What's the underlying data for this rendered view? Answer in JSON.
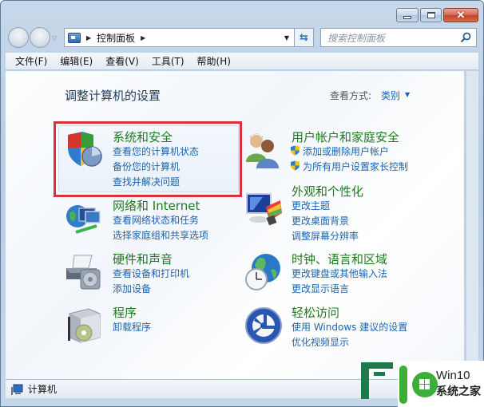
{
  "window": {
    "caption_buttons": {
      "minimize": "minimize",
      "maximize": "maximize",
      "close": "close"
    }
  },
  "navbar": {
    "address_crumbs": [
      "控制面板"
    ],
    "search_placeholder": "搜索控制面板"
  },
  "menubar": {
    "items": [
      "文件(F)",
      "编辑(E)",
      "查看(V)",
      "工具(T)",
      "帮助(H)"
    ]
  },
  "content": {
    "title": "调整计算机的设置",
    "view_by_label": "查看方式:",
    "view_by_value": "类别",
    "categories": [
      {
        "title": "系统和安全",
        "icon": "shield-chart-icon",
        "links": [
          "查看您的计算机状态",
          "备份您的计算机",
          "查找并解决问题"
        ],
        "highlighted": true
      },
      {
        "title": "用户帐户和家庭安全",
        "icon": "users-icon",
        "links": [
          "添加或删除用户帐户",
          "为所有用户设置家长控制"
        ]
      },
      {
        "title": "网络和 Internet",
        "icon": "network-globe-icon",
        "links": [
          "查看网络状态和任务",
          "选择家庭组和共享选项"
        ]
      },
      {
        "title": "外观和个性化",
        "icon": "monitor-palette-icon",
        "links": [
          "更改主题",
          "更改桌面背景",
          "调整屏幕分辨率"
        ]
      },
      {
        "title": "硬件和声音",
        "icon": "printer-icon",
        "links": [
          "查看设备和打印机",
          "添加设备"
        ]
      },
      {
        "title": "时钟、语言和区域",
        "icon": "globe-clock-icon",
        "links": [
          "更改键盘或其他输入法",
          "更改显示语言"
        ]
      },
      {
        "title": "程序",
        "icon": "program-box-icon",
        "links": [
          "卸载程序"
        ]
      },
      {
        "title": "轻松访问",
        "icon": "ease-of-access-icon",
        "links": [
          "使用 Windows 建议的设置",
          "优化视频显示"
        ]
      }
    ]
  },
  "statusbar": {
    "text": "计算机"
  },
  "watermark": {
    "line1": "Win10",
    "line2": "系统之家"
  },
  "colors": {
    "category_title": "#1f7a1f",
    "link": "#1a63b0",
    "highlight_border": "#d8323a"
  }
}
